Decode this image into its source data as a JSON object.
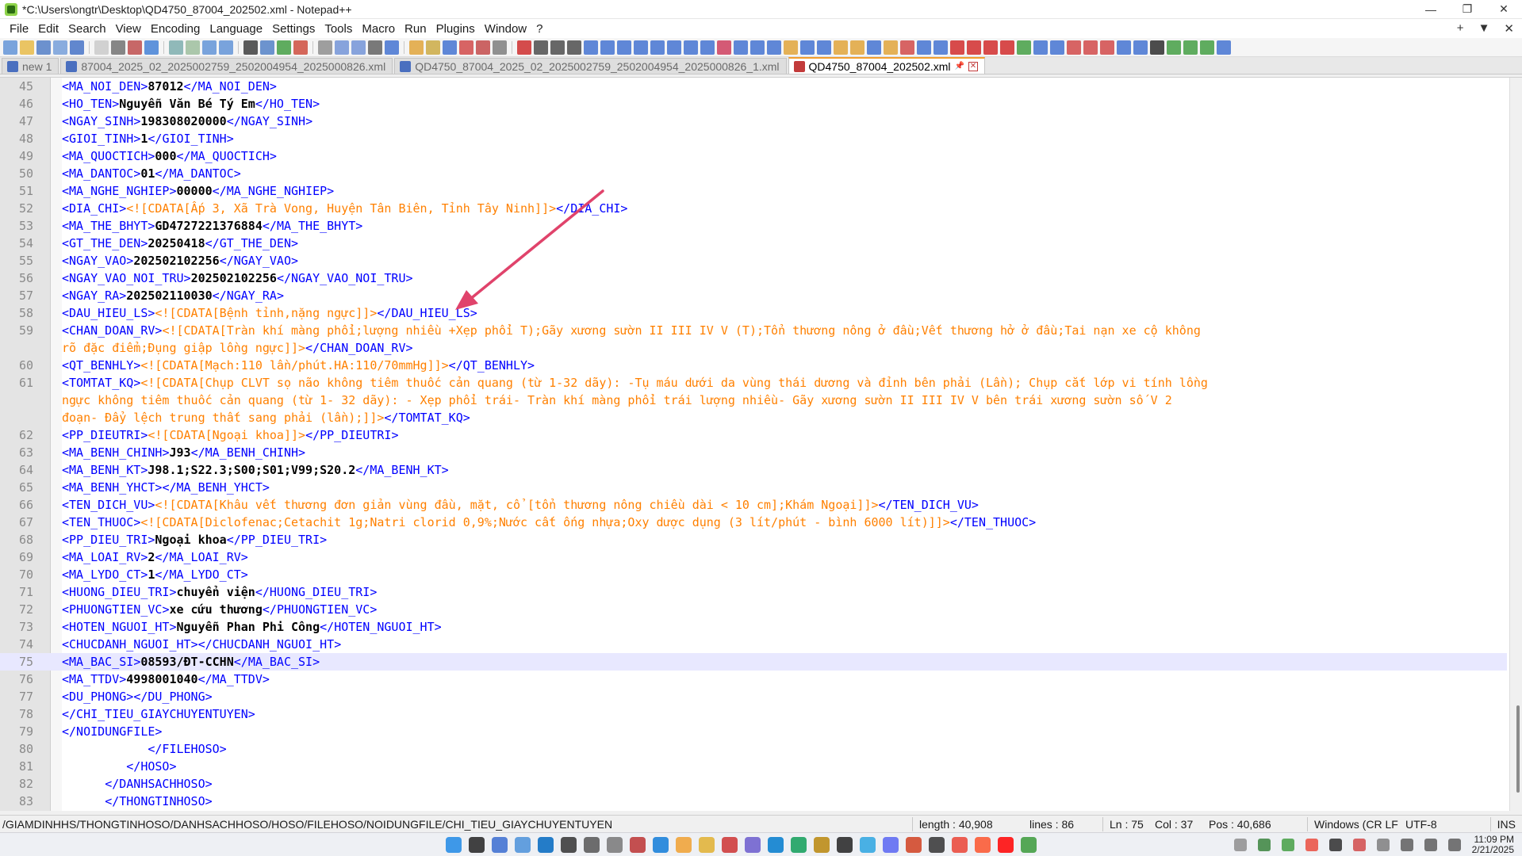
{
  "window": {
    "title": "*C:\\Users\\ongtr\\Desktop\\QD4750_87004_202502.xml - Notepad++",
    "controls": {
      "minimize": "—",
      "restore": "❐",
      "close": "✕"
    }
  },
  "menu": {
    "items": [
      "File",
      "Edit",
      "Search",
      "View",
      "Encoding",
      "Language",
      "Settings",
      "Tools",
      "Macro",
      "Run",
      "Plugins",
      "Window",
      "?"
    ],
    "right": [
      "+",
      "▼",
      "✕"
    ]
  },
  "tabs": [
    {
      "label": "new 1",
      "state": "saved"
    },
    {
      "label": "87004_2025_02_2025002759_2502004954_2025000826.xml",
      "state": "saved"
    },
    {
      "label": "QD4750_87004_2025_02_2025002759_2502004954_2025000826_1.xml",
      "state": "saved"
    },
    {
      "label": "QD4750_87004_202502.xml",
      "state": "unsaved",
      "active": true
    }
  ],
  "editor": {
    "current_line": 75,
    "lines": [
      {
        "n": "45",
        "indent": "",
        "tag": "MA_NOI_DEN",
        "value": "87012",
        "type": "val"
      },
      {
        "n": "46",
        "indent": "",
        "tag": "HO_TEN",
        "value": "Nguyễn Văn Bé Tý Em",
        "type": "val"
      },
      {
        "n": "47",
        "indent": "",
        "tag": "NGAY_SINH",
        "value": "198308020000",
        "type": "val"
      },
      {
        "n": "48",
        "indent": "",
        "tag": "GIOI_TINH",
        "value": "1",
        "type": "val"
      },
      {
        "n": "49",
        "indent": "",
        "tag": "MA_QUOCTICH",
        "value": "000",
        "type": "val"
      },
      {
        "n": "50",
        "indent": "",
        "tag": "MA_DANTOC",
        "value": "01",
        "type": "val"
      },
      {
        "n": "51",
        "indent": "",
        "tag": "MA_NGHE_NGHIEP",
        "value": "00000",
        "type": "val"
      },
      {
        "n": "52",
        "indent": "",
        "tag": "DIA_CHI",
        "value": "<![CDATA[Ấp 3, Xã Trà Vong, Huyện Tân Biên, Tỉnh Tây Ninh]]>",
        "type": "cdata"
      },
      {
        "n": "53",
        "indent": "",
        "tag": "MA_THE_BHYT",
        "value": "GD4727221376884",
        "type": "val"
      },
      {
        "n": "54",
        "indent": "",
        "tag": "GT_THE_DEN",
        "value": "20250418",
        "type": "val"
      },
      {
        "n": "55",
        "indent": "",
        "tag": "NGAY_VAO",
        "value": "202502102256",
        "type": "val"
      },
      {
        "n": "56",
        "indent": "",
        "tag": "NGAY_VAO_NOI_TRU",
        "value": "202502102256",
        "type": "val"
      },
      {
        "n": "57",
        "indent": "",
        "tag": "NGAY_RA",
        "value": "202502110030",
        "type": "val"
      },
      {
        "n": "58",
        "indent": "",
        "tag": "DAU_HIEU_LS",
        "value": "<![CDATA[Bệnh tỉnh,nặng ngực]]>",
        "type": "cdata"
      },
      {
        "n": "59",
        "indent": "",
        "tag": "CHAN_DOAN_RV",
        "value": "<![CDATA[Tràn khí màng phổi;lượng nhiều +Xẹp phổi T);Gãy xương sườn II III IV V (T);Tổn thương nông ở đầu;Vết thương hở ở đầu;Tai nạn xe cộ không",
        "type": "cdata",
        "open_only": true
      },
      {
        "n": "",
        "indent": "",
        "cont": "rõ đặc điểm;Đụng giập lồng ngực]]>",
        "close_tag": "CHAN_DOAN_RV"
      },
      {
        "n": "60",
        "indent": "",
        "tag": "QT_BENHLY",
        "value": "<![CDATA[Mạch:110 lần/phút.HA:110/70mmHg]]>",
        "type": "cdata"
      },
      {
        "n": "61",
        "indent": "",
        "tag": "TOMTAT_KQ",
        "value": "<![CDATA[Chụp CLVT sọ não không tiêm thuốc cản quang (từ 1-32 dãy): -Tụ máu dưới da vùng thái dương và đỉnh bên phải (Lần); Chụp cắt lớp vi tính lồng",
        "type": "cdata",
        "open_only": true
      },
      {
        "n": "",
        "indent": "",
        "cont": "ngực không tiêm thuốc cản quang (từ 1- 32 dãy): - Xẹp phổi trái- Tràn khí màng phổi trái lượng nhiều- Gãy xương sườn II III IV V bên trái xương sườn số V 2"
      },
      {
        "n": "",
        "indent": "",
        "cont": "đoạn- Đẩy lệch trung thất sang phải (lần);]]>",
        "close_tag": "TOMTAT_KQ"
      },
      {
        "n": "62",
        "indent": "",
        "tag": "PP_DIEUTRI",
        "value": "<![CDATA[Ngoại khoa]]>",
        "type": "cdata"
      },
      {
        "n": "63",
        "indent": "",
        "tag": "MA_BENH_CHINH",
        "value": "J93",
        "type": "val"
      },
      {
        "n": "64",
        "indent": "",
        "tag": "MA_BENH_KT",
        "value": "J98.1;S22.3;S00;S01;V99;S20.2",
        "type": "val"
      },
      {
        "n": "65",
        "indent": "",
        "tag": "MA_BENH_YHCT",
        "value": "",
        "type": "val"
      },
      {
        "n": "66",
        "indent": "",
        "tag": "TEN_DICH_VU",
        "value": "<![CDATA[Khâu vết thương đơn giản vùng đầu, mặt, cổ [tổn thương nông chiều dài < 10 cm];Khám Ngoại]]>",
        "type": "cdata"
      },
      {
        "n": "67",
        "indent": "",
        "tag": "TEN_THUOC",
        "value": "<![CDATA[Diclofenac;Cetachit 1g;Natri clorid 0,9%;Nước cất ống nhựa;Oxy dược dụng (3 lít/phút - bình 6000 lít)]]>",
        "type": "cdata"
      },
      {
        "n": "68",
        "indent": "",
        "tag": "PP_DIEU_TRI",
        "value": "Ngoại khoa",
        "type": "val"
      },
      {
        "n": "69",
        "indent": "",
        "tag": "MA_LOAI_RV",
        "value": "2",
        "type": "val"
      },
      {
        "n": "70",
        "indent": "",
        "tag": "MA_LYDO_CT",
        "value": "1",
        "type": "val"
      },
      {
        "n": "71",
        "indent": "",
        "tag": "HUONG_DIEU_TRI",
        "value": "chuyển viện",
        "type": "val"
      },
      {
        "n": "72",
        "indent": "",
        "tag": "PHUONGTIEN_VC",
        "value": "xe cứu thương",
        "type": "val"
      },
      {
        "n": "73",
        "indent": "",
        "tag": "HOTEN_NGUOI_HT",
        "value": "Nguyễn Phan Phi Công",
        "type": "val"
      },
      {
        "n": "74",
        "indent": "",
        "tag": "CHUCDANH_NGUOI_HT",
        "value": "",
        "type": "val"
      },
      {
        "n": "75",
        "indent": "",
        "tag": "MA_BAC_SI",
        "value": "08593/ĐT-CCHN",
        "type": "val"
      },
      {
        "n": "76",
        "indent": "",
        "tag": "MA_TTDV",
        "value": "4998001040",
        "type": "val"
      },
      {
        "n": "77",
        "indent": "",
        "tag": "DU_PHONG",
        "value": "",
        "type": "val"
      },
      {
        "n": "78",
        "indent": "",
        "raw": "</CHI_TIEU_GIAYCHUYENTUYEN>"
      },
      {
        "n": "79",
        "indent": "",
        "raw": "</NOIDUNGFILE>",
        "outdent": true
      },
      {
        "n": "80",
        "indent": "            ",
        "raw": "</FILEHOSO>",
        "outdent": true
      },
      {
        "n": "81",
        "indent": "         ",
        "raw": "</HOSO>",
        "outdent": true
      },
      {
        "n": "82",
        "indent": "      ",
        "raw": "</DANHSACHHOSO>",
        "outdent": true
      },
      {
        "n": "83",
        "indent": "      ",
        "raw": "</THONGTINHOSO>",
        "outdent": true
      }
    ]
  },
  "statusbar": {
    "path": "/GIAMDINHHS/THONGTINHOSO/DANHSACHHOSO/HOSO/FILEHOSO/NOIDUNGFILE/CHI_TIEU_GIAYCHUYENTUYEN",
    "length": "length : 40,908",
    "lines": "lines : 86",
    "ln": "Ln : 75",
    "col": "Col : 37",
    "pos": "Pos : 40,686",
    "eol": "Windows (CR LF",
    "encoding": "UTF-8",
    "mode": "INS"
  },
  "taskbar": {
    "time": "11:09 PM",
    "date": "2/21/2025"
  },
  "colors": {
    "tag": "#0000ff",
    "cdata": "#ff8000",
    "value": "#000000",
    "arrow": "#e0436b",
    "current_line": "#e8e8ff"
  }
}
